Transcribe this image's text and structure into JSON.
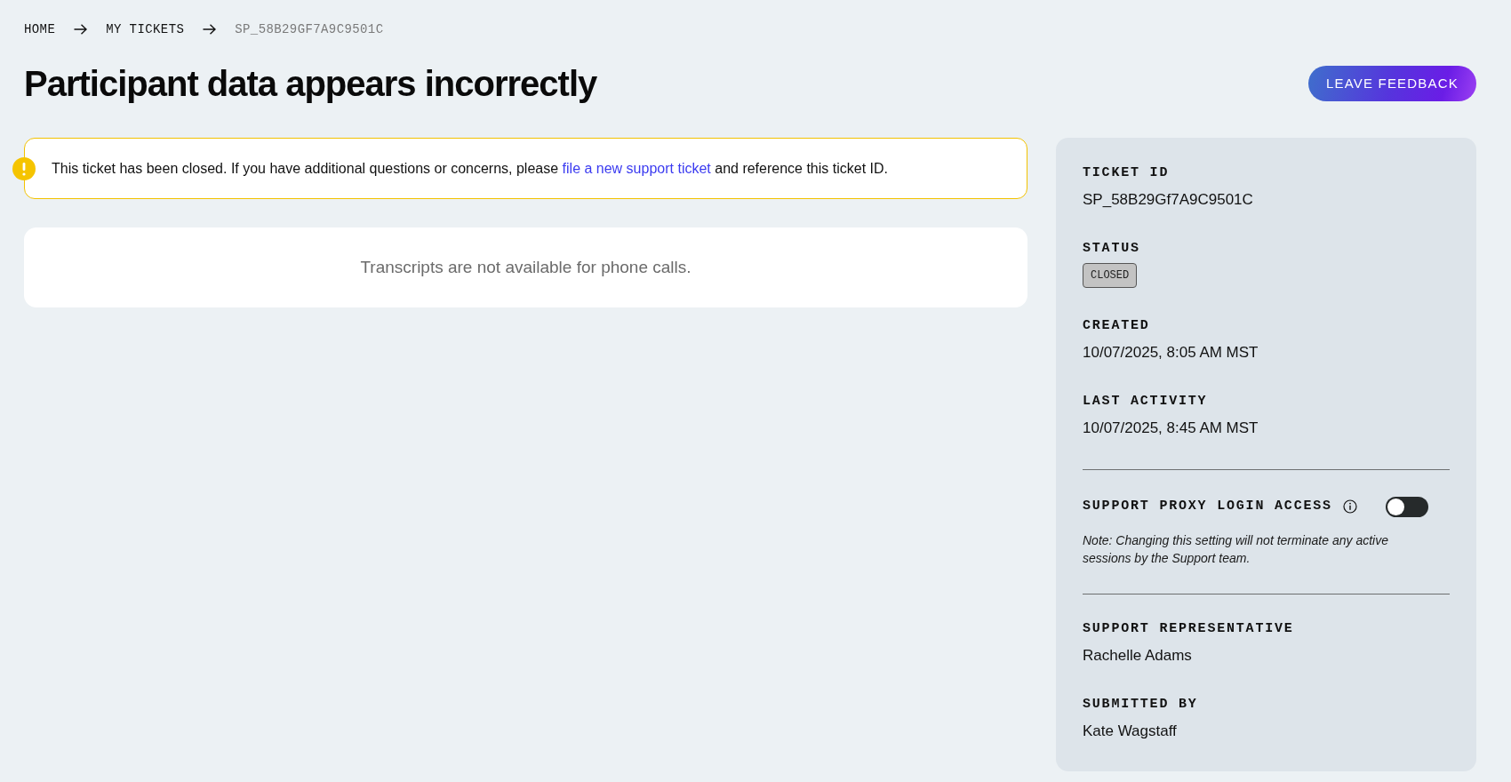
{
  "breadcrumb": [
    {
      "label": "HOME",
      "current": false
    },
    {
      "label": "MY TICKETS",
      "current": false
    },
    {
      "label": "SP_58B29GF7A9C9501C",
      "current": true
    }
  ],
  "title": "Participant data appears incorrectly",
  "feedback_button": {
    "label": "LEAVE FEEDBACK"
  },
  "alert": {
    "text": "This ticket has been closed. If you have additional questions or concerns, please",
    "link": "file a new support ticket",
    "text_after": "and reference this ticket ID."
  },
  "transcript_notice": "Transcripts are not available for phone calls.",
  "details": {
    "fields": [
      {
        "kind": "text",
        "label": "TICKET ID",
        "value": "SP_58B29Gf7A9C9501C"
      },
      {
        "kind": "badge",
        "label": "STATUS",
        "value": "CLOSED"
      },
      {
        "kind": "text",
        "label": "CREATED",
        "value": "10/07/2025, 8:05 AM MST"
      },
      {
        "kind": "text",
        "label": "LAST ACTIVITY",
        "value": "10/07/2025, 8:45 AM MST"
      }
    ],
    "proxy_access": {
      "label": "SUPPORT PROXY LOGIN ACCESS",
      "on": false,
      "note": "Note: Changing this setting will not terminate any active sessions by the Support team."
    },
    "people": [
      {
        "label": "SUPPORT REPRESENTATIVE",
        "value": "Rachelle Adams"
      },
      {
        "label": "SUBMITTED BY",
        "value": "Kate Wagstaff"
      }
    ]
  }
}
